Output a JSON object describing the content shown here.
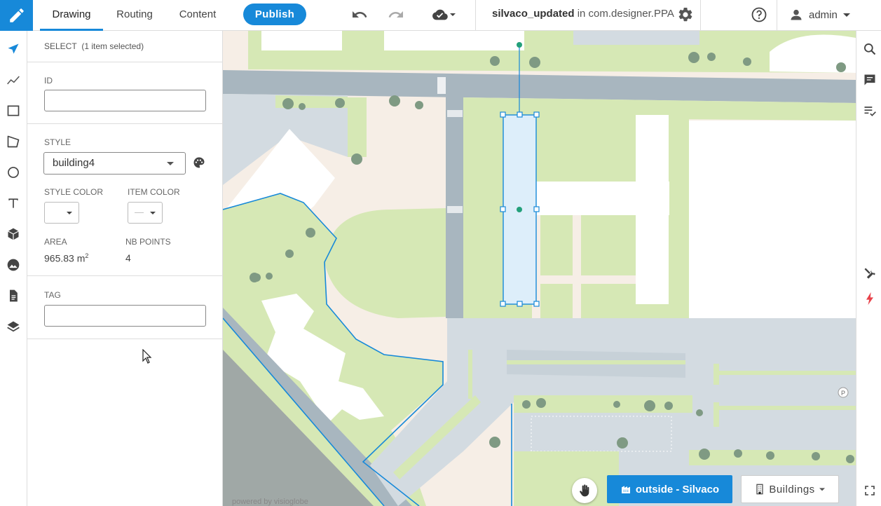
{
  "topbar": {
    "tabs": [
      {
        "label": "Drawing",
        "active": true
      },
      {
        "label": "Routing",
        "active": false
      },
      {
        "label": "Content",
        "active": false
      }
    ],
    "publish_label": "Publish",
    "project_name": "silvaco_updated",
    "project_in": " in com.designer.PPA",
    "user": "admin",
    "icons": [
      "pencil-icon",
      "undo-icon",
      "redo-icon",
      "cloud-check-icon",
      "gear-icon",
      "help-icon",
      "user-icon"
    ]
  },
  "left_tools": [
    "select-arrow-icon",
    "polyline-icon",
    "rectangle-icon",
    "polygon-icon",
    "circle-icon",
    "text-icon",
    "cube-icon",
    "image-icon",
    "document-icon",
    "layers-icon"
  ],
  "panel": {
    "select_title": "SELECT",
    "select_count": "(1 item selected)",
    "id_label": "ID",
    "id_value": "",
    "style_label": "STYLE",
    "style_value": "building4",
    "style_color_label": "STYLE COLOR",
    "item_color_label": "ITEM COLOR",
    "item_color_value": "—",
    "area_label": "AREA",
    "area_value": "965.83 m",
    "area_unit_sup": "2",
    "nb_points_label": "NB POINTS",
    "nb_points_value": "4",
    "tag_label": "TAG",
    "tag_value": ""
  },
  "right_tools": [
    "search-icon",
    "comment-icon",
    "checklist-icon",
    "tools-icon",
    "lightning-icon",
    "fullscreen-icon"
  ],
  "map": {
    "venue_button": "outside - Silvaco",
    "layer_button": "Buttons",
    "layer_button_text": "Buildings",
    "parking_marker": "P",
    "credit": "powered by visioglobe",
    "colors": {
      "grass": "#d6e8b5",
      "road": "#a8b6bf",
      "parking": "#d3dbe1",
      "building": "#ffffff",
      "ground": "#f6eee6",
      "tree": "#7f9a83",
      "selection": "#1789d9",
      "selected_fill": "#ddeefa"
    }
  }
}
